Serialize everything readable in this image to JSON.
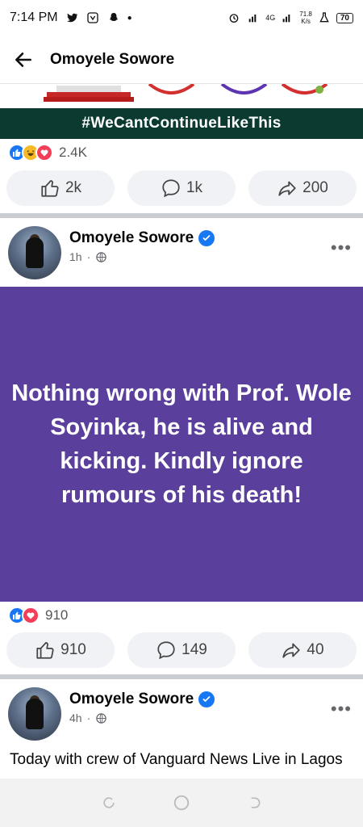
{
  "status_bar": {
    "time": "7:14 PM",
    "network": "4G",
    "speed_value": "71.8",
    "speed_unit": "K/s",
    "battery": "70"
  },
  "top_bar": {
    "title": "Omoyele Sowore"
  },
  "prev_post": {
    "banner_text": "#WeCantContinueLikeThis",
    "reaction_count": "2.4K",
    "like_count": "2k",
    "comment_count": "1k",
    "share_count": "200"
  },
  "post1": {
    "author": "Omoyele Sowore",
    "time": "1h",
    "text": "Nothing wrong with Prof. Wole Soyinka, he is alive and kicking. Kindly ignore rumours of his death!",
    "background_color": "#5b3f9c",
    "reaction_count": "910",
    "like_count": "910",
    "comment_count": "149",
    "share_count": "40"
  },
  "post2": {
    "author": "Omoyele Sowore",
    "time": "4h",
    "caption": "Today with crew of Vanguard News Live in Lagos"
  },
  "icons": {
    "back": "arrow-left-icon",
    "verified": "verified-badge-icon",
    "privacy": "globe-icon",
    "more": "more-horizontal-icon",
    "like": "thumbs-up-icon",
    "comment": "comment-icon",
    "share": "share-arrow-icon"
  },
  "colors": {
    "accent": "#1877f2",
    "banner": "#0b3a30"
  }
}
